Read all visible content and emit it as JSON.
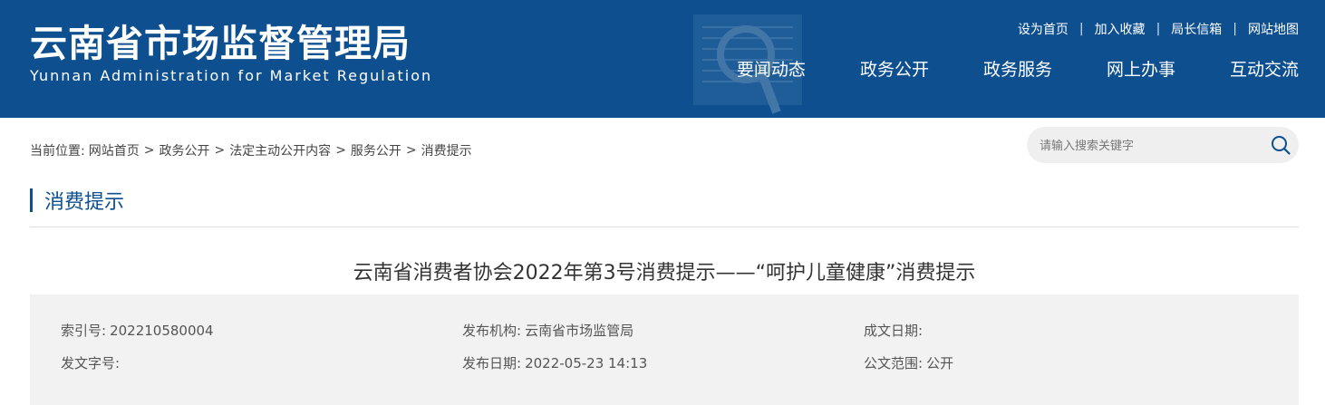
{
  "header": {
    "title_cn": "云南省市场监督管理局",
    "title_en": "Yunnan Administration for Market Regulation",
    "top_links": [
      "设为首页",
      "加入收藏",
      "局长信箱",
      "网站地图"
    ],
    "top_sep": "|",
    "nav": [
      "要闻动态",
      "政务公开",
      "政务服务",
      "网上办事",
      "互动交流"
    ]
  },
  "breadcrumb": {
    "prefix": "当前位置:",
    "items": [
      "网站首页",
      "政务公开",
      "法定主动公开内容",
      "服务公开",
      "消费提示"
    ],
    "sep": ">"
  },
  "search": {
    "placeholder": "请输入搜索关键字"
  },
  "section": {
    "title": "消费提示"
  },
  "article": {
    "title": "云南省消费者协会2022年第3号消费提示——“呵护儿童健康”消费提示",
    "meta": {
      "index_label": "索引号:",
      "index_value": "202210580004",
      "org_label": "发布机构:",
      "org_value": "云南省市场监管局",
      "written_label": "成文日期:",
      "written_value": "",
      "doc_label": "发文字号:",
      "doc_value": "",
      "pub_label": "发布日期:",
      "pub_value": "2022-05-23 14:13",
      "scope_label": "公文范围:",
      "scope_value": "公开"
    }
  },
  "colors": {
    "brand": "#0d4f8f",
    "meta_bg": "#f2f2f2"
  }
}
